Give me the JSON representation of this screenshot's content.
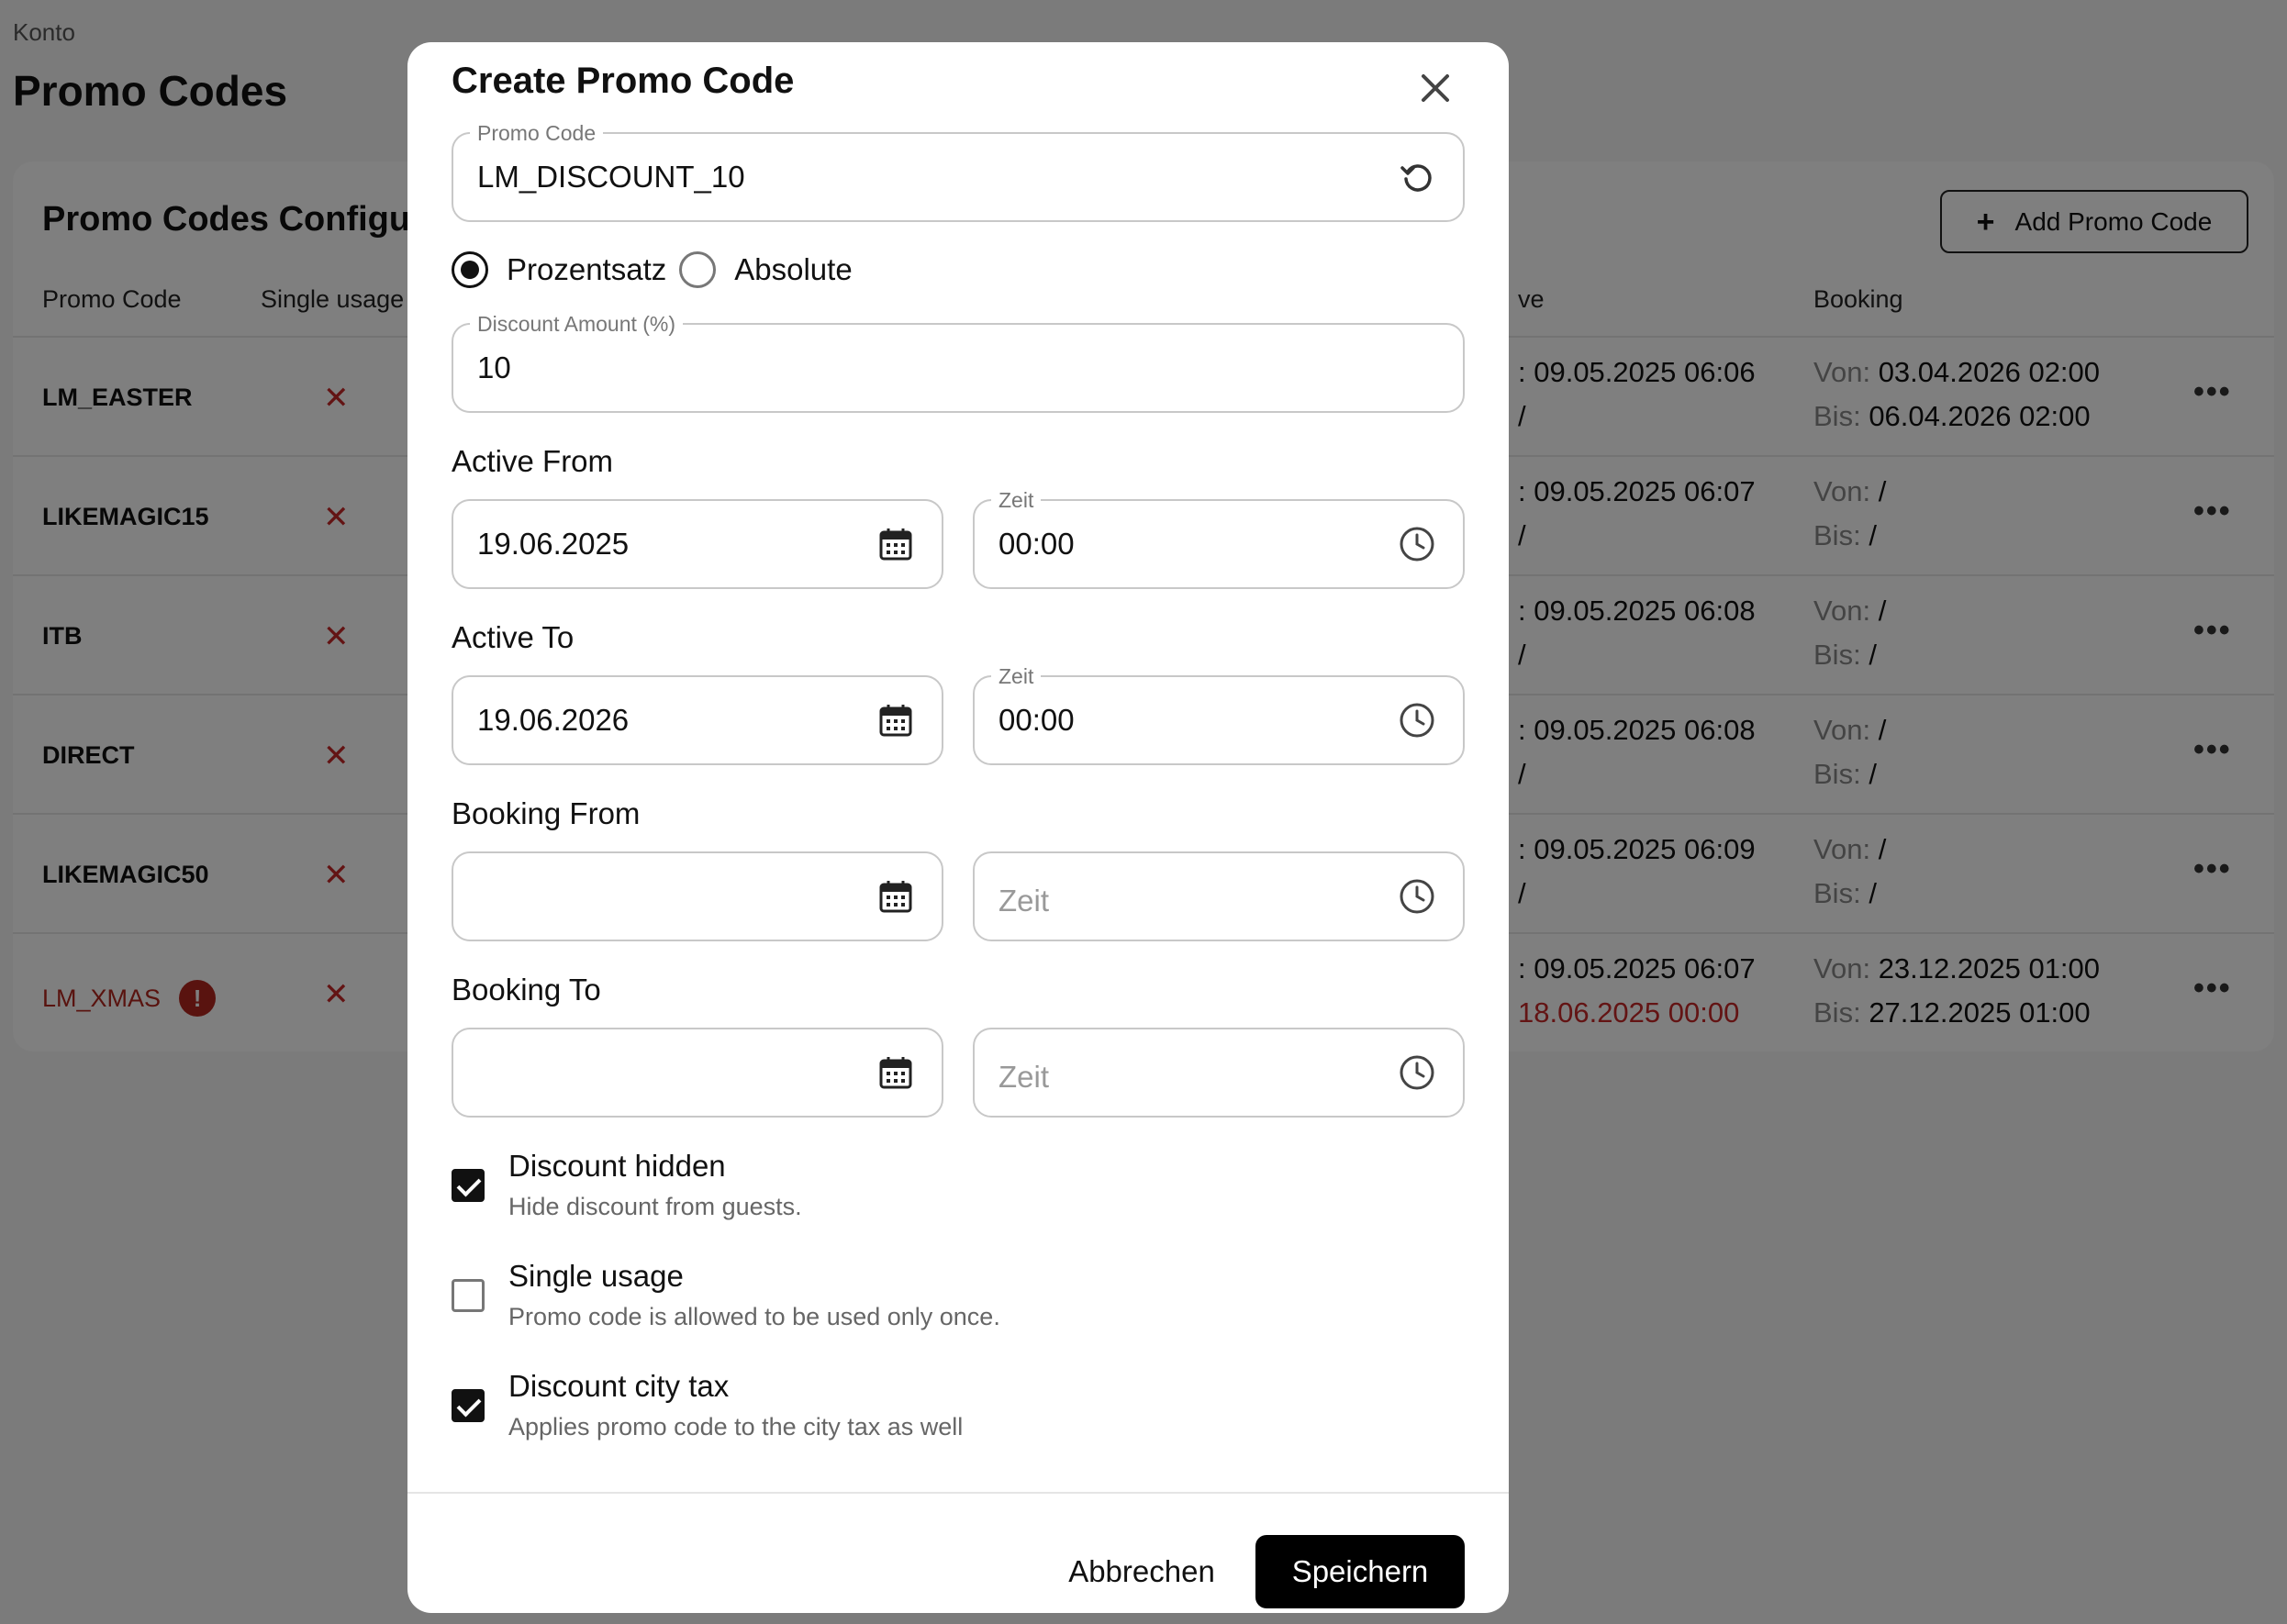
{
  "background": {
    "breadcrumb": "Konto",
    "page_title": "Promo Codes",
    "card_title": "Promo Codes Configu",
    "add_button_label": "Add Promo Code",
    "columns": [
      "Promo Code",
      "Single usage",
      "ve",
      "Booking"
    ],
    "rows": [
      {
        "code": "LM_EASTER",
        "single": "✕",
        "active_from": ": 09.05.2025 06:06",
        "active_to": "/",
        "booking_from_label": "Von:",
        "booking_from": "03.04.2026 02:00",
        "booking_to_label": "Bis:",
        "booking_to": "06.04.2026 02:00"
      },
      {
        "code": "LIKEMAGIC15",
        "single": "✕",
        "active_from": ": 09.05.2025 06:07",
        "active_to": "/",
        "booking_from_label": "Von:",
        "booking_from": "/",
        "booking_to_label": "Bis:",
        "booking_to": "/"
      },
      {
        "code": "ITB",
        "single": "✕",
        "active_from": ": 09.05.2025 06:08",
        "active_to": "/",
        "booking_from_label": "Von:",
        "booking_from": "/",
        "booking_to_label": "Bis:",
        "booking_to": "/"
      },
      {
        "code": "DIRECT",
        "single": "✕",
        "active_from": ": 09.05.2025 06:08",
        "active_to": "/",
        "booking_from_label": "Von:",
        "booking_from": "/",
        "booking_to_label": "Bis:",
        "booking_to": "/"
      },
      {
        "code": "LIKEMAGIC50",
        "single": "✕",
        "active_from": ": 09.05.2025 06:09",
        "active_to": "/",
        "booking_from_label": "Von:",
        "booking_from": "/",
        "booking_to_label": "Bis:",
        "booking_to": "/"
      },
      {
        "code": "LM_XMAS",
        "single": "✕",
        "active_from": ": 09.05.2025 06:07",
        "active_to": "18.06.2025 00:00",
        "booking_from_label": "Von:",
        "booking_from": "23.12.2025 01:00",
        "booking_to_label": "Bis:",
        "booking_to": "27.12.2025 01:00",
        "expired": true,
        "badge": "!"
      }
    ],
    "row_menu": "•••"
  },
  "dialog": {
    "title": "Create Promo Code",
    "promo_code": {
      "label": "Promo Code",
      "value": "LM_DISCOUNT_10"
    },
    "discount_type": {
      "options": [
        "Prozentsatz",
        "Absolute"
      ],
      "selected": "Prozentsatz"
    },
    "discount_amount": {
      "label": "Discount Amount (%)",
      "value": "10"
    },
    "active_from": {
      "label": "Active From",
      "date": "19.06.2025",
      "time_label": "Zeit",
      "time": "00:00"
    },
    "active_to": {
      "label": "Active To",
      "date": "19.06.2026",
      "time_label": "Zeit",
      "time": "00:00"
    },
    "booking_from": {
      "label": "Booking From",
      "date": "",
      "time_placeholder": "Zeit"
    },
    "booking_to": {
      "label": "Booking To",
      "date": "",
      "time_placeholder": "Zeit"
    },
    "checks": [
      {
        "title": "Discount hidden",
        "desc": "Hide discount from guests.",
        "checked": true
      },
      {
        "title": "Single usage",
        "desc": "Promo code is allowed to be used only once.",
        "checked": false
      },
      {
        "title": "Discount city tax",
        "desc": "Applies promo code to the city tax as well",
        "checked": true
      }
    ],
    "cancel_label": "Abbrechen",
    "save_label": "Speichern"
  }
}
